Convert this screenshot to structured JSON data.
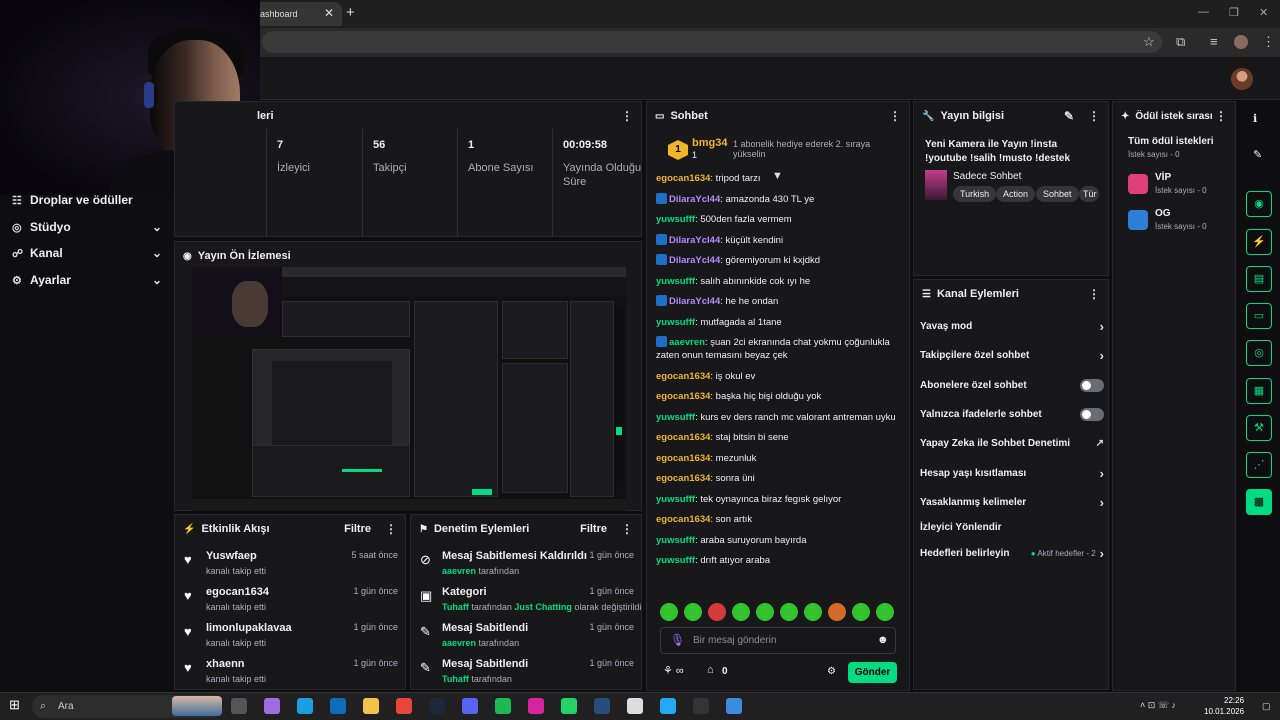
{
  "browser": {
    "tab_title": "ashboard"
  },
  "sidebar": {
    "items": [
      {
        "label": "Droplar ve ödüller",
        "icon": "grid-icon"
      },
      {
        "label": "Stüdyo",
        "icon": "studio-icon"
      },
      {
        "label": "Kanal",
        "icon": "channel-icon"
      },
      {
        "label": "Ayarlar",
        "icon": "gear-icon"
      }
    ]
  },
  "stats": {
    "title_fragment": "leri",
    "items": [
      {
        "value": "7",
        "label": "İzleyici"
      },
      {
        "value": "56",
        "label": "Takipçi"
      },
      {
        "value": "1",
        "label": "Abone Sayısı"
      },
      {
        "value": "00:09:58",
        "label": "Yayında Olduğu Süre"
      }
    ]
  },
  "preview": {
    "title": "Yayın Ön İzlemesi"
  },
  "events": {
    "title": "Etkinlik Akışı",
    "filter": "Filtre",
    "rows": [
      {
        "name": "Yuswfaep",
        "sub": "kanalı takip etti",
        "time": "5 saat önce"
      },
      {
        "name": "egocan1634",
        "sub": "kanalı takip etti",
        "time": "1 gün önce"
      },
      {
        "name": "limonlupaklavaa",
        "sub": "kanalı takip etti",
        "time": "1 gün önce"
      },
      {
        "name": "xhaenn",
        "sub": "kanalı takip etti",
        "time": "1 gün önce"
      }
    ]
  },
  "moderation": {
    "title": "Denetim Eylemleri",
    "filter": "Filtre",
    "rows": [
      {
        "name": "Mesaj Sabitlemesi Kaldırıldı",
        "user": "aaevren",
        "suffix": "tarafından",
        "extra_a": "",
        "extra_b": "",
        "time": "1 gün önce"
      },
      {
        "name": "Kategori",
        "user": "Tuhaff",
        "suffix": "tarafından",
        "extra_a": "Just Chatting",
        "extra_b": "olarak değiştirildi",
        "time": "1 gün önce"
      },
      {
        "name": "Mesaj Sabitlendi",
        "user": "aaevren",
        "suffix": "tarafından",
        "extra_a": "",
        "extra_b": "",
        "time": "1 gün önce"
      },
      {
        "name": "Mesaj Sabitlendi",
        "user": "Tuhaff",
        "suffix": "tarafından",
        "extra_a": "",
        "extra_b": "",
        "time": "1 gün önce"
      }
    ]
  },
  "chat": {
    "title": "Sohbet",
    "hype": {
      "rank": "1",
      "name": "bmg34",
      "count": "1",
      "message": "1 abonelik hediye ederek 2. sıraya yükselin"
    },
    "messages": [
      {
        "user": "egocan1634",
        "color": "#f0b429",
        "badge": false,
        "text": "tripod tarzı"
      },
      {
        "user": "DilaraYcl44",
        "color": "#b48cff",
        "badge": true,
        "text": "amazonda 430 TL ye"
      },
      {
        "user": "yuwsufff",
        "color": "#00db84",
        "badge": false,
        "text": "500den fazla vermem"
      },
      {
        "user": "DilaraYcl44",
        "color": "#b48cff",
        "badge": true,
        "text": "küçült kendini"
      },
      {
        "user": "DilaraYcl44",
        "color": "#b48cff",
        "badge": true,
        "text": "göremiyorum ki kxjdkd"
      },
      {
        "user": "yuwsufff",
        "color": "#00db84",
        "badge": false,
        "text": "salıh abınınkide cok ıyı he"
      },
      {
        "user": "DilaraYcl44",
        "color": "#b48cff",
        "badge": true,
        "text": "he he ondan"
      },
      {
        "user": "yuwsufff",
        "color": "#00db84",
        "badge": false,
        "text": "mutfagada al 1tane"
      },
      {
        "user": "aaevren",
        "color": "#00db84",
        "badge": true,
        "text": "şuan 2ci ekranında chat yokmu çoğunlukla zaten onun temasını beyaz çek"
      },
      {
        "user": "egocan1634",
        "color": "#f0b429",
        "badge": false,
        "text": "iş okul ev"
      },
      {
        "user": "egocan1634",
        "color": "#f0b429",
        "badge": false,
        "text": "başka hiç bişi olduğu yok"
      },
      {
        "user": "yuwsufff",
        "color": "#00db84",
        "badge": false,
        "text": "kurs ev ders ranch mc valorant antreman uyku"
      },
      {
        "user": "egocan1634",
        "color": "#f0b429",
        "badge": false,
        "text": "staj bitsin bi sene"
      },
      {
        "user": "egocan1634",
        "color": "#f0b429",
        "badge": false,
        "text": "mezunluk"
      },
      {
        "user": "egocan1634",
        "color": "#f0b429",
        "badge": false,
        "text": "sonra üni"
      },
      {
        "user": "yuwsufff",
        "color": "#00db84",
        "badge": false,
        "text": "tek oynayınca biraz fegısk gelıyor"
      },
      {
        "user": "egocan1634",
        "color": "#f0b429",
        "badge": false,
        "text": "son artık"
      },
      {
        "user": "yuwsufff",
        "color": "#00db84",
        "badge": false,
        "text": "araba suruyorum bayırda"
      },
      {
        "user": "yuwsufff",
        "color": "#00db84",
        "badge": false,
        "text": "drıft atıyor araba"
      }
    ],
    "input_placeholder": "Bir mesaj gönderin",
    "points": "0",
    "send_label": "Gönder"
  },
  "stream_info": {
    "title": "Yayın bilgisi",
    "stream_title": "Yeni Kamera ile Yayın !insta !youtube !salih !musto !destek",
    "category": "Sadece Sohbet",
    "tags": [
      "Turkish",
      "Action",
      "Sohbet",
      "Tür"
    ]
  },
  "channel_actions": {
    "title": "Kanal Eylemleri",
    "items": [
      {
        "label": "Yavaş mod",
        "control": "arrow"
      },
      {
        "label": "Takipçilere özel sohbet",
        "control": "arrow"
      },
      {
        "label": "Abonelere özel sohbet",
        "control": "toggle"
      },
      {
        "label": "Yalnızca ifadelerle sohbet",
        "control": "toggle"
      },
      {
        "label": "Yapay Zeka ile Sohbet Denetimi",
        "control": "external"
      },
      {
        "label": "Hesap yaşı kısıtlaması",
        "control": "arrow"
      },
      {
        "label": "Yasaklanmış kelimeler",
        "control": "arrow"
      },
      {
        "label": "İzleyici Yönlendir",
        "control": "none"
      },
      {
        "label": "Hedefleri belirleyin",
        "control": "arrow"
      }
    ],
    "goals_status": "Aktif hedefler - 2"
  },
  "rewards": {
    "title": "Ödül istek sırası",
    "all_label": "Tüm ödül istekleri",
    "all_count": "İstek sayısı - 0",
    "items": [
      {
        "name": "VİP",
        "count": "İstek sayısı - 0",
        "color": "#e0407a"
      },
      {
        "name": "OG",
        "count": "İstek sayısı - 0",
        "color": "#2d7fd6"
      }
    ]
  },
  "taskbar": {
    "search_placeholder": "Ara",
    "time": "22:26",
    "date": "10.01.2026"
  },
  "colors": {
    "accent": "#00db84",
    "panel": "#18181b",
    "bg": "#0e0e10"
  }
}
